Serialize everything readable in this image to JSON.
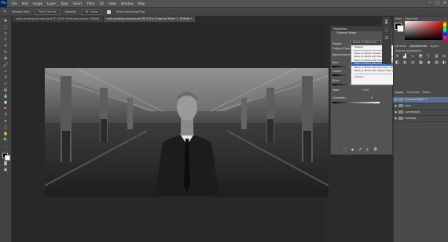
{
  "menubar": {
    "app_logo": "Ps",
    "items": [
      "File",
      "Edit",
      "Image",
      "Layer",
      "Type",
      "Select",
      "Filter",
      "3D",
      "View",
      "Window",
      "Help"
    ],
    "window_controls": [
      "−",
      "□",
      "✕"
    ]
  },
  "options_bar": {
    "sample_size_label": "Sample Size:",
    "sample_size_value": "Point Sample",
    "sample_label": "Sample:",
    "sample_value": "All Layers",
    "show_ring_label": "Show Sampling Ring"
  },
  "tabs": [
    {
      "label": "color-grading-samples.psd @ 100% (Portraits-comps, RGB/8)"
    },
    {
      "label": "color-grading-charms.psd @ 121% (Channel Mixer 1, RGB/8) *"
    }
  ],
  "properties": {
    "title": "Properties",
    "subtitle": "Channel Mixer",
    "preset_label": "Preset:",
    "preset_value": "Black & White wi...",
    "output_channel_label": "Output Channel:",
    "monochrome_label": "Monochrome",
    "red_label": "Red:",
    "green_label": "Green:",
    "blue_label": "Blue:",
    "total_label": "Total:",
    "total_value": "+100",
    "constant_label": "Constant:",
    "constant_value": "0"
  },
  "preset_dropdown": {
    "items": [
      {
        "label": "Default",
        "selected": false
      },
      {
        "label": "Black & White Infrared (RGB)",
        "selected": false
      },
      {
        "label": "Black & White with Blue Filter (RGB)",
        "selected": false
      },
      {
        "label": "Black & White with Green Filter (RGB)",
        "selected": false
      },
      {
        "label": "Black & White with Orange Filter (RGB)",
        "selected": true
      },
      {
        "label": "Black & White with Red Filter (RGB)",
        "selected": false
      },
      {
        "label": "Black & White with Yellow Filter (RGB)",
        "selected": false
      },
      {
        "label": "Custom",
        "selected": false
      }
    ]
  },
  "right_panels": {
    "color_tabs": [
      "Color",
      "Swatches"
    ],
    "adjust_tabs": [
      "Libraries",
      "Adjustments",
      "Styles"
    ],
    "add_adjustment_label": "Add an adjustment",
    "layer_tabs": [
      "Layers",
      "Channels",
      "Paths"
    ],
    "layers": [
      {
        "name": "Channel Mixer 1",
        "selected": true
      },
      {
        "name": "Lens",
        "selected": false
      },
      {
        "name": "Luminosity",
        "selected": false
      },
      {
        "name": "Grading",
        "selected": false
      }
    ]
  }
}
